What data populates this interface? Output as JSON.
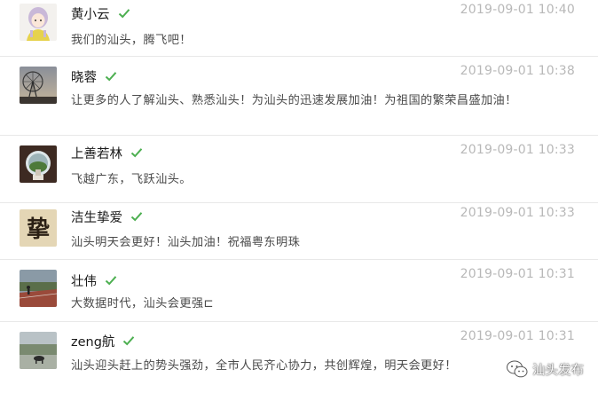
{
  "comments": [
    {
      "name": "黄小云",
      "timestamp": "2019-09-01 10:40",
      "text": "我们的汕头，腾飞吧！",
      "verified_icon": "check-icon"
    },
    {
      "name": "晓蓉",
      "timestamp": "2019-09-01 10:38",
      "text": "让更多的人了解汕头、熟悉汕头！为汕头的迅速发展加油！为祖国的繁荣昌盛加油！",
      "verified_icon": "check-icon"
    },
    {
      "name": "上善若林",
      "timestamp": "2019-09-01 10:33",
      "text": "飞越广东，飞跃汕头。",
      "verified_icon": "check-icon"
    },
    {
      "name": "洁生挚爱",
      "timestamp": "2019-09-01 10:33",
      "text": "汕头明天会更好！汕头加油！祝福粤东明珠",
      "verified_icon": "check-icon"
    },
    {
      "name": "壮伟",
      "timestamp": "2019-09-01 10:31",
      "text": "大数据时代，汕头会更强⊏",
      "verified_icon": "check-icon"
    },
    {
      "name": "zeng航",
      "timestamp": "2019-09-01 10:31",
      "text": "汕头迎头赶上的势头强劲，全市人民齐心协力，共创辉煌，明天会更好！",
      "verified_icon": "check-icon"
    }
  ],
  "avatar4_glyph": "挚",
  "watermark": {
    "text": "汕头发布",
    "icon": "wechat-icon"
  },
  "colors": {
    "check": "#4caf50",
    "name": "#1a1a1a",
    "timestamp": "#b8b8b8",
    "text": "#4a4a4a",
    "divider": "#e8e8e8"
  }
}
